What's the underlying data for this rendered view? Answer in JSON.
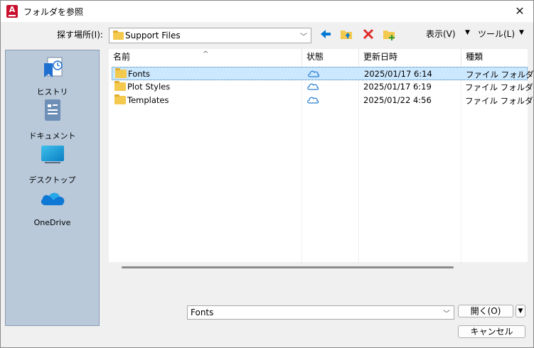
{
  "title": {
    "text": "フォルダを参照",
    "icon": "autocad-icon",
    "app_icon_letter": "A"
  },
  "toolbar": {
    "look_in_label": "探す場所(I):",
    "look_in_value": "Support Files",
    "view_label": "表示(V)",
    "tools_label": "ツール(L)"
  },
  "places": [
    {
      "label": "ヒストリ",
      "icon": "history-icon"
    },
    {
      "label": "ドキュメント",
      "icon": "documents-icon"
    },
    {
      "label": "デスクトップ",
      "icon": "desktop-icon"
    },
    {
      "label": "OneDrive",
      "icon": "onedrive-icon"
    }
  ],
  "list": {
    "columns": [
      "名前",
      "状態",
      "更新日時",
      "種類"
    ],
    "rows": [
      {
        "name": "Fonts",
        "date": "2025/01/17 6:14",
        "type": "ファイル フォルダー",
        "selected": true
      },
      {
        "name": "Plot Styles",
        "date": "2025/01/17 6:19",
        "type": "ファイル フォルダー",
        "selected": false
      },
      {
        "name": "Templates",
        "date": "2025/01/22 4:56",
        "type": "ファイル フォルダー",
        "selected": false
      }
    ]
  },
  "footer": {
    "filename_value": "Fonts",
    "open_label": "開く(O)",
    "cancel_label": "キャンセル"
  },
  "colors": {
    "accent": "#0078d4",
    "delete": "#e02b2b",
    "folder": "#f3c94e",
    "places_bg": "#b9c9da",
    "selection": "#cce8ff"
  }
}
